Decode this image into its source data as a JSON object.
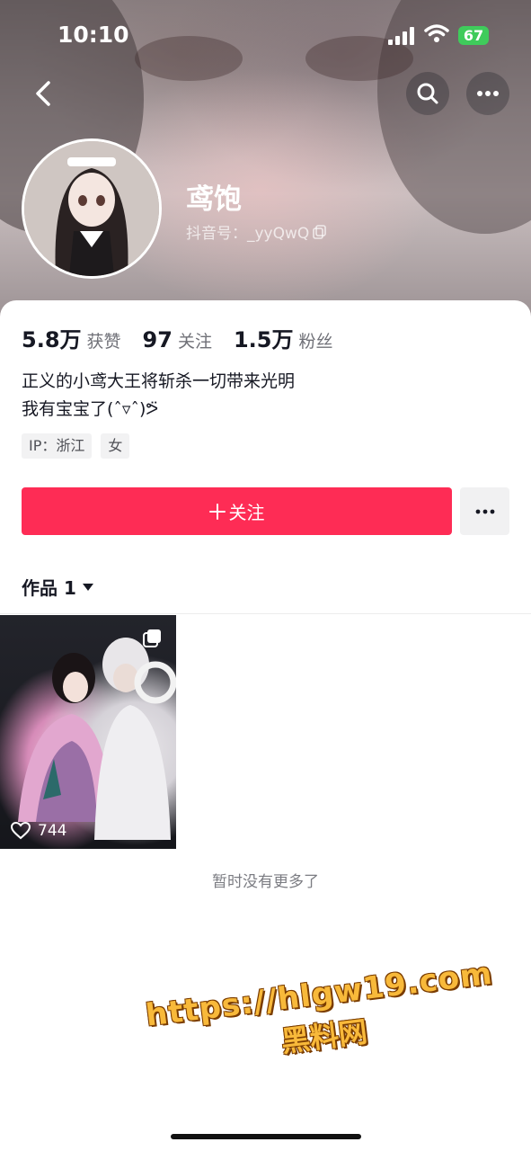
{
  "status_bar": {
    "time": "10:10",
    "battery": "67"
  },
  "profile": {
    "nickname": "鸢饱",
    "douyin_id": "抖音号：_yyQwQ",
    "stats": [
      {
        "value": "5.8万",
        "label": "获赞"
      },
      {
        "value": "97",
        "label": "关注"
      },
      {
        "value": "1.5万",
        "label": "粉丝"
      }
    ],
    "bio": [
      "正义的小鸢大王将斩杀一切带来光明",
      "我有宝宝了(ˆ▿ˆ)ᕗ̈"
    ],
    "tags": [
      "IP：浙江",
      "女"
    ],
    "follow_label": "关注"
  },
  "works": {
    "tab_label": "作品 1",
    "items": [
      {
        "likes": "744"
      }
    ],
    "footer": "暂时没有更多了"
  },
  "watermark": {
    "url": "https://hlgw19.com",
    "name": "黑料网"
  },
  "colors": {
    "accent": "#fe2c55",
    "battery": "#3fcb5b",
    "watermark": "#f8b93a"
  }
}
